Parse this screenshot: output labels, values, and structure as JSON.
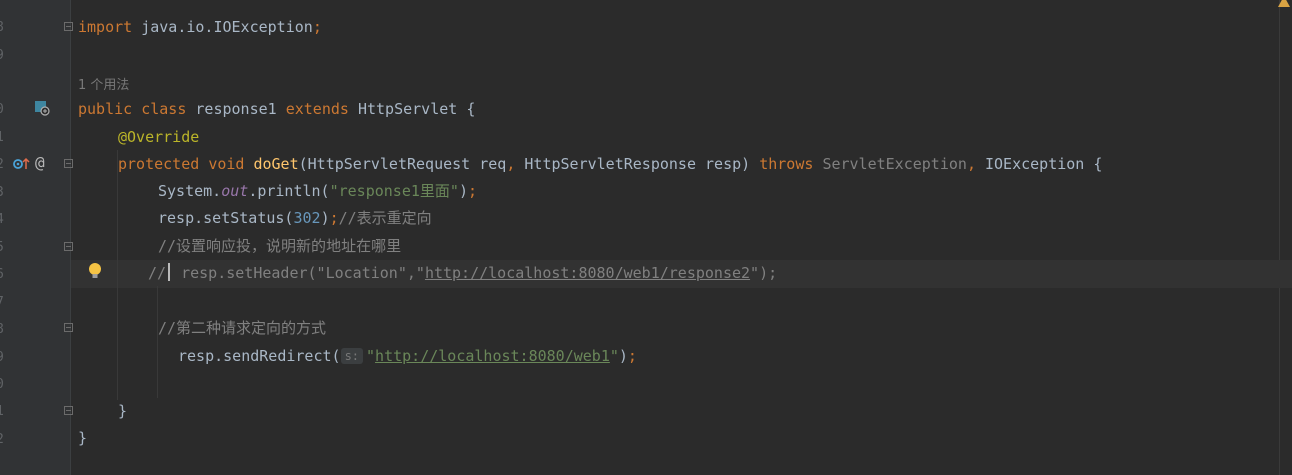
{
  "editor": {
    "line_numbers": [
      "8",
      "9",
      "",
      "0",
      "1",
      "2",
      "3",
      "4",
      "5",
      "6",
      "7",
      "8",
      "9",
      "0",
      "1",
      "2"
    ],
    "usage_hint": "1 个用法",
    "lines": {
      "l1": {
        "kw": "import",
        "rest": " java.io.IOException",
        "semi": ";"
      },
      "l3": {
        "kw1": "public",
        "kw2": "class",
        "name": " response1 ",
        "kw3": "extends",
        "rest": " HttpServlet {"
      },
      "l4": {
        "ann": "@Override"
      },
      "l5": {
        "kw1": "protected",
        "kw2": "void",
        "fn": "doGet",
        "p1": "(HttpServletRequest req",
        "comma1": ",",
        "p2": " HttpServletResponse resp)",
        "throws": "throws",
        "ex1": "ServletException",
        "comma2": ",",
        "ex2": " IOException {"
      },
      "l6": {
        "a": "System.",
        "out": "out",
        "b": ".println(",
        "str": "\"response1里面\"",
        "c": ")",
        "semi": ";"
      },
      "l7": {
        "a": "resp.setStatus(",
        "num": "302",
        "b": ")",
        "semi": ";",
        "cmt": "//表示重定向"
      },
      "l8": {
        "cmt": "//设置响应投，说明新的地址在哪里"
      },
      "l9": {
        "slash": "//",
        "a": " resp.setHeader(\"Location\",\"",
        "url": "http://localhost:8080/web1/response2",
        "b": "\");"
      },
      "l11": {
        "cmt": "//第二种请求定向的方式"
      },
      "l12": {
        "a": "resp.sendRedirect(",
        "hint": "s:",
        "q1": "\"",
        "url": "http://localhost:8080/web1",
        "q2": "\"",
        "b": ")",
        "semi": ";"
      },
      "l14": {
        "text": "}"
      },
      "l15": {
        "text": "}"
      }
    },
    "colors": {
      "background": "#2b2b2b",
      "keyword": "#cc7832",
      "string": "#6a8759",
      "function": "#ffc66d",
      "annotation": "#bbb529",
      "number": "#6897bb",
      "comment": "#808080"
    }
  }
}
